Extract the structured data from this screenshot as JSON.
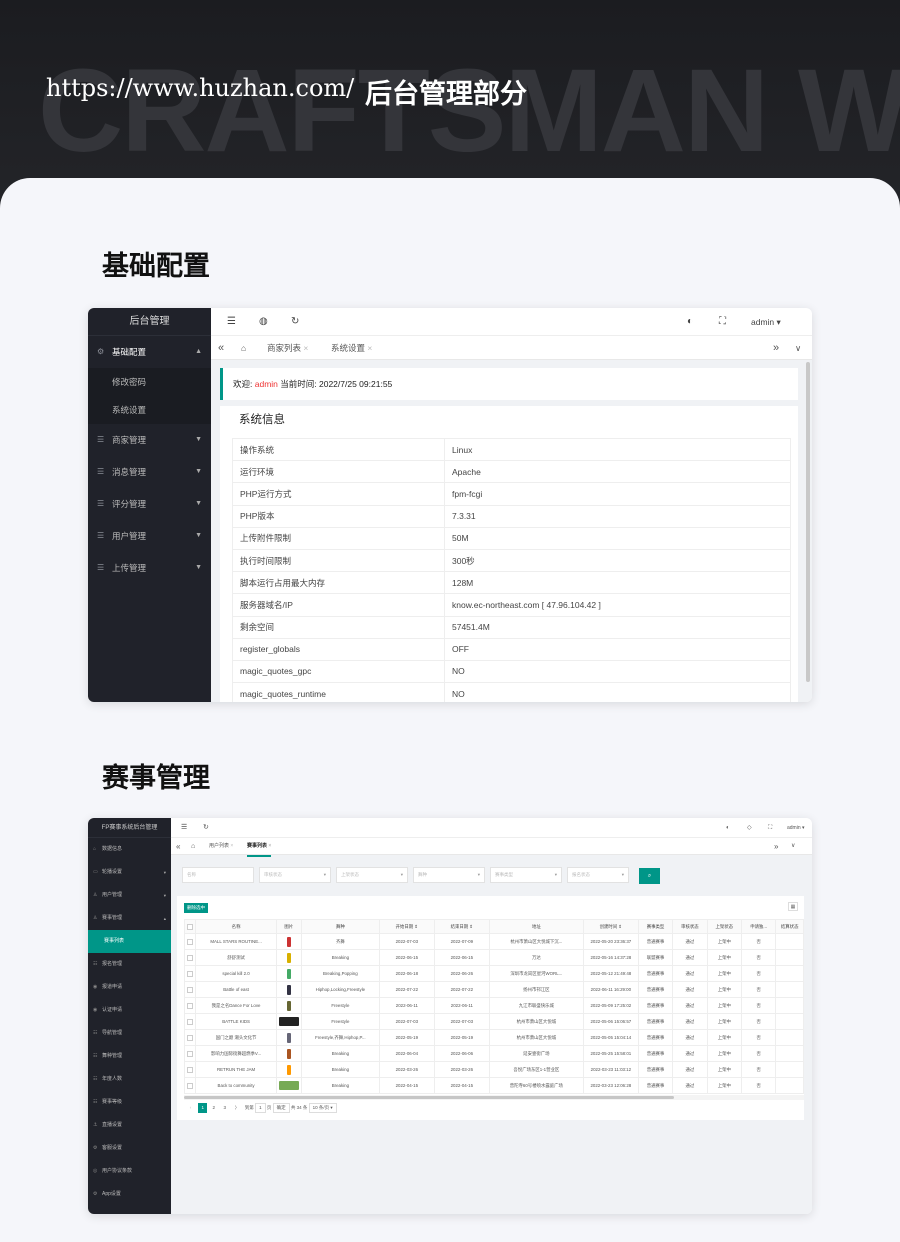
{
  "hero": {
    "bg_text": "CRAFTSMAN WE",
    "url": "https://www.huzhan.com/",
    "title": "后台管理部分"
  },
  "sections": {
    "basic": "基础配置",
    "events": "赛事管理"
  },
  "panel1": {
    "brand": "后台管理",
    "menu": {
      "basic": "基础配置",
      "sub": [
        "修改密码",
        "系统设置"
      ],
      "items": [
        "商家管理",
        "消息管理",
        "评分管理",
        "用户管理",
        "上传管理"
      ]
    },
    "user": "admin",
    "tabs": [
      "商家列表",
      "系统设置"
    ],
    "welcome": {
      "prefix": "欢迎:",
      "user": "admin",
      "time": "当前时间: 2022/7/25 09:21:55"
    },
    "info_title": "系统信息",
    "info": [
      {
        "k": "操作系统",
        "v": "Linux"
      },
      {
        "k": "运行环境",
        "v": "Apache"
      },
      {
        "k": "PHP运行方式",
        "v": "fpm-fcgi"
      },
      {
        "k": "PHP版本",
        "v": "7.3.31"
      },
      {
        "k": "上传附件限制",
        "v": "50M"
      },
      {
        "k": "执行时间限制",
        "v": "300秒"
      },
      {
        "k": "脚本运行占用最大内存",
        "v": "128M"
      },
      {
        "k": "服务器域名/IP",
        "v": "know.ec-northeast.com [ 47.96.104.42 ]"
      },
      {
        "k": "剩余空间",
        "v": "57451.4M"
      },
      {
        "k": "register_globals",
        "v": "OFF"
      },
      {
        "k": "magic_quotes_gpc",
        "v": "NO"
      },
      {
        "k": "magic_quotes_runtime",
        "v": "NO"
      }
    ]
  },
  "panel2": {
    "brand": "FP赛事系统后台管理",
    "menu": [
      {
        "label": "数据信息",
        "arrow": ""
      },
      {
        "label": "轮播设置",
        "arrow": "▾"
      },
      {
        "label": "用户管理",
        "arrow": "▾"
      },
      {
        "label": "赛事管理",
        "arrow": "▴"
      },
      {
        "label": "赛事列表",
        "arrow": "",
        "active": true
      },
      {
        "label": "报名管理",
        "arrow": ""
      },
      {
        "label": "报道申请",
        "arrow": ""
      },
      {
        "label": "认证申请",
        "arrow": ""
      },
      {
        "label": "导航管理",
        "arrow": ""
      },
      {
        "label": "舞种管理",
        "arrow": ""
      },
      {
        "label": "年度人数",
        "arrow": ""
      },
      {
        "label": "赛事等级",
        "arrow": ""
      },
      {
        "label": "直播设置",
        "arrow": ""
      },
      {
        "label": "客服设置",
        "arrow": ""
      },
      {
        "label": "用户协议条款",
        "arrow": ""
      },
      {
        "label": "App设置",
        "arrow": ""
      }
    ],
    "user": "admin",
    "tabs": [
      "用户列表",
      "赛事列表"
    ],
    "filters": [
      "名称",
      "审核状态",
      "上架状态",
      "舞种",
      "赛事类型",
      "报名状态"
    ],
    "delete_btn": "删除选中",
    "columns": [
      "名称",
      "图片",
      "舞种",
      "开始日期 ⇕",
      "结束日期 ⇕",
      "地址",
      "创建时间 ⇕",
      "赛事类型",
      "审核状态",
      "上架状态",
      "申请独...",
      "结算状态"
    ],
    "rows": [
      [
        "MALL STARS ROUTINE...",
        "",
        "齐舞",
        "2022-07-03",
        "2022-07-09",
        "杭州市萧山区大悦城下沉...",
        "2022-05-20 23:36:37",
        "普通赛事",
        "通过",
        "上架中",
        "否",
        ""
      ],
      [
        "舒舒测试",
        "",
        "Breaking",
        "2022-06-15",
        "2022-06-15",
        "万达",
        "2022-05-16 14:37:28",
        "联盟赛事",
        "通过",
        "上架中",
        "否",
        ""
      ],
      [
        "special kill 2.0",
        "",
        "Breaking,Popping",
        "2022-06-18",
        "2022-06-26",
        "深圳市龙岗区星河WORL...",
        "2022-05-12 21:49:48",
        "普通赛事",
        "通过",
        "上架中",
        "否",
        ""
      ],
      [
        "Battle of east",
        "",
        "Hiphop,Locking,Freestyle",
        "2022-07-22",
        "2022-07-22",
        "扬州市邗江区",
        "2022-06-11 16:29:00",
        "普通赛事",
        "通过",
        "上架中",
        "否",
        ""
      ],
      [
        "我是之名Dance For Love",
        "",
        "Freestyle",
        "2022-06-11",
        "2022-06-11",
        "九江市联盛快乐城",
        "2022-05-09 17:25:02",
        "普通赛事",
        "通过",
        "上架中",
        "否",
        ""
      ],
      [
        "BATTLE KIDS",
        "",
        "Freestyle",
        "2022-07-03",
        "2022-07-03",
        "杭州市萧山区大悦城",
        "2022-05-06 15:06:57",
        "普通赛事",
        "通过",
        "上架中",
        "否",
        ""
      ],
      [
        "国门之巅 潮头文化节",
        "",
        "Freestyle,齐舞,Hiphop,P...",
        "2022-05-19",
        "2022-05-19",
        "杭州市萧山区大悦城",
        "2022-05-05 15:04:14",
        "普通赛事",
        "通过",
        "上架中",
        "否",
        ""
      ],
      [
        "影响力国际街舞超燃季V...",
        "",
        "Breaking",
        "2022-06-04",
        "2022-06-06",
        "延安壹街广场",
        "2022-05-25 15:58:01",
        "普通赛事",
        "通过",
        "上架中",
        "否",
        ""
      ],
      [
        "RETRUN THE JAM",
        "",
        "Breaking",
        "2022-03-26",
        "2022-03-26",
        "吾悦广场东区1-1营业区",
        "2022-03-23 11:03:12",
        "普通赛事",
        "通过",
        "上架中",
        "否",
        ""
      ],
      [
        "Back to community",
        "",
        "Breaking",
        "2022-04-15",
        "2022-04-15",
        "普陀寺60号楼喷水露庭广场",
        "2022-03-23 12:06:28",
        "普通赛事",
        "通过",
        "上架中",
        "否",
        ""
      ]
    ],
    "pagination": {
      "pages": [
        "1",
        "2",
        "3"
      ],
      "next": "〉",
      "goto": "到第",
      "page_input": "1",
      "page_unit": "页",
      "confirm": "确定",
      "total": "共 34 条",
      "per_page": "10 条/页"
    },
    "colors": {
      "accent": "#009688"
    }
  }
}
